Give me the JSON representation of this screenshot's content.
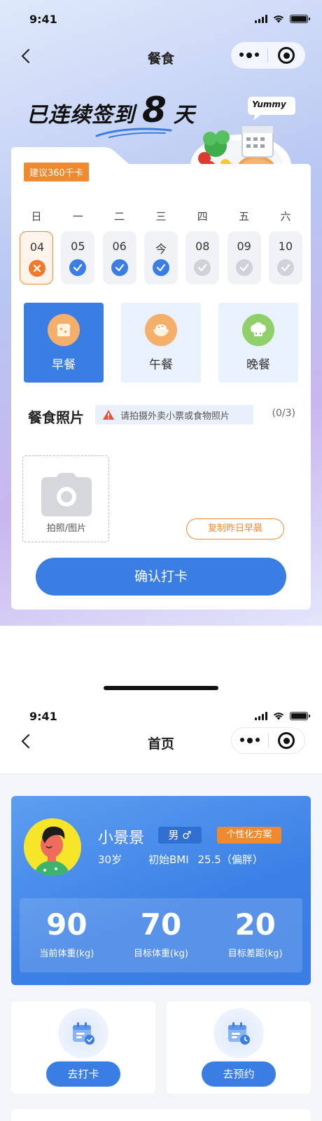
{
  "screen1": {
    "status": {
      "time": "9:41"
    },
    "nav": {
      "title": "餐食"
    },
    "streak": {
      "prefix": "已连续签到",
      "days": "8",
      "unit": "天"
    },
    "badge_yummy": "Yummy",
    "calorie_tag": "建议360千卡",
    "weekdays": [
      "日",
      "一",
      "二",
      "三",
      "四",
      "五",
      "六"
    ],
    "days": [
      {
        "label": "04",
        "status": "missed"
      },
      {
        "label": "05",
        "status": "done"
      },
      {
        "label": "06",
        "status": "done"
      },
      {
        "label": "今",
        "status": "done"
      },
      {
        "label": "08",
        "status": "pending"
      },
      {
        "label": "09",
        "status": "pending"
      },
      {
        "label": "10",
        "status": "pending"
      }
    ],
    "meals": [
      {
        "label": "早餐",
        "icon": "bread-icon",
        "active": true
      },
      {
        "label": "午餐",
        "icon": "rice-bowl-icon",
        "active": false
      },
      {
        "label": "晚餐",
        "icon": "chef-hat-icon",
        "active": false
      }
    ],
    "photo": {
      "title": "餐食照片",
      "warning": "请拍摄外卖小票或食物照片",
      "count": "(0/3)",
      "upload_label": "拍照/图片"
    },
    "copy_button": "复制昨日早晨",
    "confirm_button": "确认打卡",
    "colors": {
      "primary": "#3a7de3",
      "accent": "#f08a2f"
    }
  },
  "screen2": {
    "status": {
      "time": "9:41"
    },
    "nav": {
      "title": "首页"
    },
    "profile": {
      "name": "小景景",
      "gender": "男 ♂",
      "plan_tag": "个性化方案",
      "age": "30岁",
      "bmi_label": "初始BMI",
      "bmi_value": "25.5（偏胖）"
    },
    "stats": [
      {
        "value": "90",
        "label": "当前体重(kg)"
      },
      {
        "value": "70",
        "label": "目标体重(kg)"
      },
      {
        "value": "20",
        "label": "目标差距(kg)"
      }
    ],
    "actions": [
      {
        "label": "去打卡",
        "icon": "calendar-check-icon"
      },
      {
        "label": "去预约",
        "icon": "calendar-clock-icon"
      }
    ]
  }
}
